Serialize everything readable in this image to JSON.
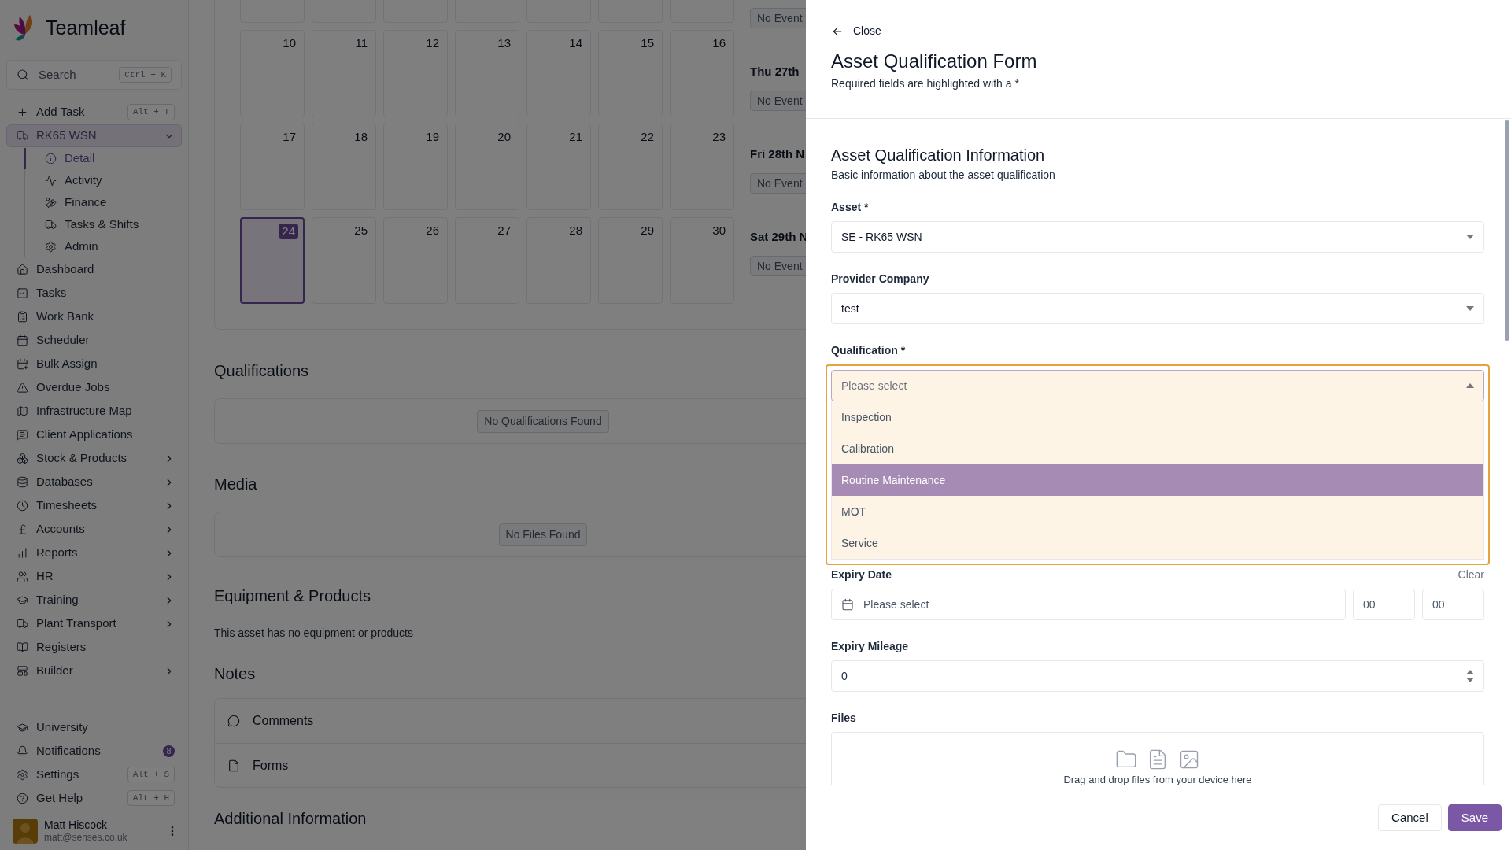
{
  "sidebar": {
    "brand": "Teamleaf",
    "search": {
      "placeholder": "Search",
      "shortcut": "Ctrl + K"
    },
    "items": [
      {
        "label": "Add Task",
        "shortcut": "Alt + T",
        "selected": false
      },
      {
        "label": "RK65 WSN",
        "selected": true,
        "expanded": true,
        "children": [
          {
            "label": "Detail",
            "selected": true
          },
          {
            "label": "Activity",
            "selected": false
          },
          {
            "label": "Finance",
            "selected": false
          },
          {
            "label": "Tasks & Shifts",
            "selected": false
          },
          {
            "label": "Admin",
            "selected": false
          }
        ]
      },
      {
        "label": "Dashboard",
        "selected": false
      },
      {
        "label": "Tasks",
        "selected": false
      },
      {
        "label": "Work Bank",
        "selected": false
      },
      {
        "label": "Scheduler",
        "selected": false
      },
      {
        "label": "Bulk Assign",
        "selected": false
      },
      {
        "label": "Overdue Jobs",
        "selected": false
      },
      {
        "label": "Infrastructure Map",
        "selected": false
      },
      {
        "label": "Client Applications",
        "selected": false
      },
      {
        "label": "Stock & Products",
        "selected": false,
        "expanded": false
      },
      {
        "label": "Databases",
        "selected": false,
        "expanded": false
      },
      {
        "label": "Timesheets",
        "selected": false,
        "expanded": false
      },
      {
        "label": "Accounts",
        "selected": false,
        "expanded": false
      },
      {
        "label": "Reports",
        "selected": false,
        "expanded": false
      },
      {
        "label": "HR",
        "selected": false,
        "expanded": false
      },
      {
        "label": "Training",
        "selected": false,
        "expanded": false
      },
      {
        "label": "Plant Transport",
        "selected": false,
        "expanded": false
      },
      {
        "label": "Registers",
        "selected": false
      },
      {
        "label": "Builder",
        "selected": false,
        "expanded": false
      }
    ],
    "bottom_items": [
      {
        "label": "University",
        "selected": false
      },
      {
        "label": "Notifications",
        "badge": "8",
        "selected": false
      },
      {
        "label": "Settings",
        "shortcut": "Alt + S",
        "selected": false
      },
      {
        "label": "Get Help",
        "shortcut": "Alt + H",
        "selected": false
      }
    ],
    "user": {
      "name": "Matt Hiscock",
      "email": "matt@senses.co.uk"
    }
  },
  "calendar": {
    "weeks": [
      {
        "days": [
          {
            "today": false
          },
          {
            "today": false
          },
          {
            "today": false
          },
          {
            "today": false
          },
          {
            "today": false
          },
          {
            "today": false
          },
          {
            "today": false
          }
        ]
      },
      {
        "days": [
          {
            "day": "10",
            "today": false
          },
          {
            "day": "11",
            "today": false
          },
          {
            "day": "12",
            "today": false
          },
          {
            "day": "13",
            "today": false
          },
          {
            "day": "14",
            "today": false
          },
          {
            "day": "15",
            "today": false
          },
          {
            "day": "16",
            "today": false
          }
        ]
      },
      {
        "days": [
          {
            "day": "17",
            "today": false
          },
          {
            "day": "18",
            "today": false
          },
          {
            "day": "19",
            "today": false
          },
          {
            "day": "20",
            "today": false
          },
          {
            "day": "21",
            "today": false
          },
          {
            "day": "22",
            "today": false
          },
          {
            "day": "23",
            "today": false
          }
        ]
      },
      {
        "days": [
          {
            "day": "24",
            "today": true
          },
          {
            "day": "25",
            "today": false
          },
          {
            "day": "26",
            "today": false
          },
          {
            "day": "27",
            "today": false
          },
          {
            "day": "28",
            "today": false
          },
          {
            "day": "29",
            "today": false
          },
          {
            "day": "30",
            "today": false
          }
        ]
      }
    ],
    "agenda": [
      {
        "badge": "No Event"
      },
      {
        "heading": "Thu 27th",
        "badge": "No Event"
      },
      {
        "heading": "Fri 28th N",
        "badge": "No Event"
      },
      {
        "heading": "Sat 29th N",
        "badge": "No Event"
      }
    ]
  },
  "qualifications": {
    "title": "Qualifications",
    "empty": "No Qualifications Found"
  },
  "media": {
    "title": "Media",
    "empty": "No Files Found"
  },
  "equipment": {
    "title": "Equipment & Products",
    "text": "This asset has no equipment or products"
  },
  "notes": {
    "title": "Notes",
    "items": [
      "Comments",
      "Forms"
    ]
  },
  "additional": {
    "title": "Additional Information"
  },
  "drawer": {
    "close": "Close",
    "title": "Asset Qualification Form",
    "subtitle": "Required fields are highlighted with a *",
    "section": {
      "title": "Asset Qualification Information",
      "subtitle": "Basic information about the asset qualification"
    },
    "fields": [
      {
        "kind": "select",
        "label": "Asset *",
        "value": "SE - RK65 WSN"
      },
      {
        "kind": "select",
        "label": "Provider Company",
        "value": "test"
      },
      {
        "kind": "open-select",
        "label": "Qualification *",
        "placeholder": "Please select",
        "options": [
          {
            "label": "Inspection",
            "selected": false
          },
          {
            "label": "Calibration",
            "selected": false
          },
          {
            "label": "Routine Maintenance",
            "selected": true
          },
          {
            "label": "MOT",
            "selected": false
          },
          {
            "label": "Service",
            "selected": false
          }
        ]
      },
      {
        "kind": "datetime",
        "label": "Expiry Date",
        "clear": "Clear",
        "placeholder": "Please select",
        "hour": "00",
        "minute": "00"
      },
      {
        "kind": "number",
        "label": "Expiry Mileage",
        "value": "0"
      },
      {
        "kind": "files",
        "label": "Files",
        "hint": "Drag and drop files from your device here"
      }
    ],
    "buttons": [
      {
        "label": "Cancel",
        "kind": "secondary"
      },
      {
        "label": "Save",
        "kind": "primary"
      }
    ]
  }
}
